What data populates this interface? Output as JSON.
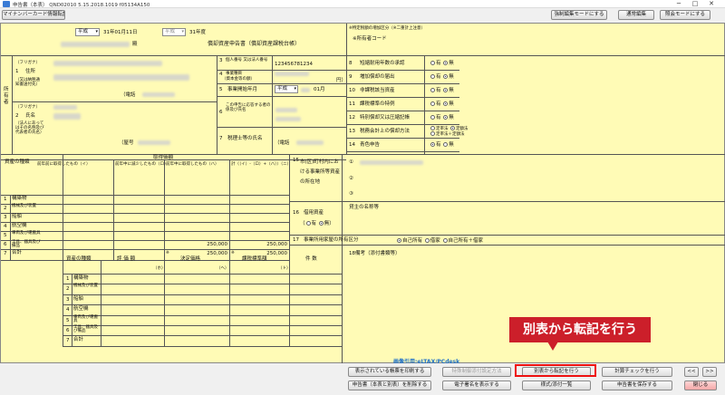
{
  "window": {
    "title": "申告書（本表）  QND02010  5.15.2018.1019  f05134A150",
    "controls": {
      "minimize": "─",
      "maximize": "□",
      "close": "✕"
    }
  },
  "toolbar": {
    "my_number_button": "マイナンバーカード情報転記",
    "force_edit_button": "強制編集モードにする",
    "normal_edit_button": "通常編集",
    "reference_mode_button": "照会モードにする"
  },
  "form": {
    "era_select": "平成",
    "date_text": "31年01月11日",
    "date_suffix": "殿",
    "era_select2": "平成",
    "year_suffix": "31年度",
    "form_title": "償却資産申告書（償却資産課税台帳）",
    "top_note": "※所有者コード",
    "top_right_note": "※特定税額の増加区分（※二重計上注意）",
    "side_label_owner": "所有者",
    "row1": {
      "num": "1",
      "kana": "（フリガナ）",
      "label": "住所",
      "note": "（又は納税通知書送付先）",
      "phone_label": "（電話"
    },
    "row2": {
      "num": "2",
      "kana": "（フリガナ）",
      "label": "氏名",
      "note": "（法人にあってはその名称及び代表者の氏名）",
      "shop_label": "（屋号"
    },
    "row3": {
      "num": "3",
      "label": "個人番号 又は法人番号",
      "value": "123456781234"
    },
    "row4": {
      "num": "4",
      "label": "事業種目",
      "note": "（資本金等の額）",
      "unit": "円）"
    },
    "row5": {
      "num": "5",
      "label": "事業開始年月",
      "era": "平成",
      "month": "01月"
    },
    "row6": {
      "num": "6",
      "label": "この申告に応答する者の係及び氏名"
    },
    "row7": {
      "num": "7",
      "label": "税理士等の氏名",
      "phone_label": "（電話"
    },
    "right_items": [
      {
        "num": "8",
        "label": "短縮耐用年数の承認",
        "yes": "有",
        "no": "無",
        "selected": "no"
      },
      {
        "num": "9",
        "label": "増加償却の届出",
        "yes": "有",
        "no": "無",
        "selected": "no"
      },
      {
        "num": "10",
        "label": "非課税該当資産",
        "yes": "有",
        "no": "無",
        "selected": "no"
      },
      {
        "num": "11",
        "label": "課税標準の特例",
        "yes": "有",
        "no": "無",
        "selected": "no"
      },
      {
        "num": "12",
        "label": "特別償却又は圧縮記帳",
        "yes": "有",
        "no": "無",
        "selected": "no"
      },
      {
        "num": "13",
        "label": "税務会計上の償却方法",
        "yes": "定率法",
        "no": "定額法",
        "extra": "定率法＋定額法",
        "selected": "no"
      },
      {
        "num": "14",
        "label": "青色申告",
        "yes": "有",
        "no": "無",
        "selected": "yes"
      }
    ],
    "acq_table": {
      "header": "取得価額",
      "col_type": "資産の種類",
      "col_a": "前年前に取得したもの（イ）",
      "col_b": "前年中に減少したもの（ロ）",
      "col_c": "前年中に取得したもの（ハ）",
      "col_d": "計（（イ）-（ロ）+（ハ））（ニ）",
      "rows": [
        {
          "num": "1",
          "name": "構築物",
          "d": ""
        },
        {
          "num": "2",
          "name": "機械及び装置",
          "d": ""
        },
        {
          "num": "3",
          "name": "船舶",
          "d": ""
        },
        {
          "num": "4",
          "name": "航空機",
          "d": ""
        },
        {
          "num": "5",
          "name": "車両及び運搬具",
          "d": ""
        },
        {
          "num": "6",
          "name": "工具、器具及び備品",
          "c": "250,000",
          "d": "250,000"
        },
        {
          "num": "7",
          "name": "合計",
          "c": "250,000",
          "d": "250,000"
        }
      ]
    },
    "row15": {
      "num": "15",
      "label": "市(区)町村内における事業所等資産の所在地",
      "items": [
        "①",
        "②",
        "③"
      ]
    },
    "row16": {
      "num": "16",
      "label": "借用資産",
      "yes": "有",
      "no": "無",
      "selected": "no"
    },
    "row17": {
      "num": "17",
      "label": "事業所用家屋の所有区分",
      "options": [
        "自己所有",
        "借家",
        "自己所有＋借家"
      ],
      "selected": "自己所有"
    },
    "lender_label": "貸主の名称等",
    "row18": {
      "num": "18",
      "label": "備考（添付書類等）"
    },
    "eval_table": {
      "col_type": "資産の種類",
      "col_a": "評 価 額",
      "col_a_sub": "（ホ）",
      "col_b": "決定価格",
      "col_b_sub": "（ヘ）",
      "col_c": "課税標準額",
      "col_c_sub": "（ト）",
      "col_d": "件 数",
      "mark": "※",
      "rows": [
        {
          "num": "1",
          "name": "構築物"
        },
        {
          "num": "2",
          "name": "機械及び装置"
        },
        {
          "num": "3",
          "name": "船舶"
        },
        {
          "num": "4",
          "name": "航空機"
        },
        {
          "num": "5",
          "name": "車両及び運搬具"
        },
        {
          "num": "6",
          "name": "工具、器具及び備品"
        },
        {
          "num": "7",
          "name": "合計"
        }
      ]
    },
    "credit": "画像引用:eLTAX/PCdesk"
  },
  "callout": "別表から転記を行う",
  "bottom": {
    "print_button": "表示されている帳票を印刷する",
    "attachment_button": "特殊制御添付設定方法",
    "transfer_button": "別表から転記を行う",
    "calc_check_button": "計算チェックを行う",
    "prev_button": "<<",
    "next_button": ">>",
    "delete_button": "申告書（本表と別表）を削除する",
    "esign_button": "電子署名を表示する",
    "form_list_button": "様式/添付一覧",
    "save_button": "申告書を保存する",
    "close_button": "閉じる"
  }
}
